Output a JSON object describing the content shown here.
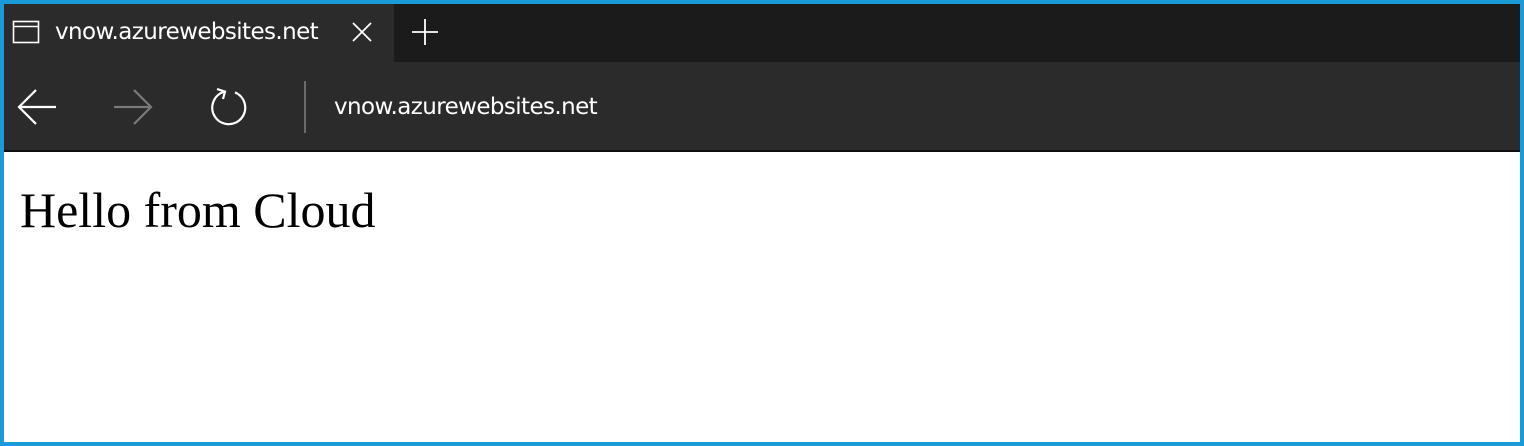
{
  "browser": {
    "tab": {
      "title": "vnow.azurewebsites.net",
      "icon": "browser-page-icon",
      "close_icon": "close-icon"
    },
    "new_tab_icon": "plus-icon",
    "nav": {
      "back_icon": "back-arrow-icon",
      "forward_icon": "forward-arrow-icon",
      "refresh_icon": "refresh-icon",
      "address": "vnow.azurewebsites.net"
    },
    "colors": {
      "frame_border": "#1a9ad6",
      "tab_strip": "#1b1b1b",
      "active_tab": "#2b2b2b",
      "nav_bar": "#2b2b2b"
    }
  },
  "page": {
    "heading": "Hello from Cloud"
  }
}
